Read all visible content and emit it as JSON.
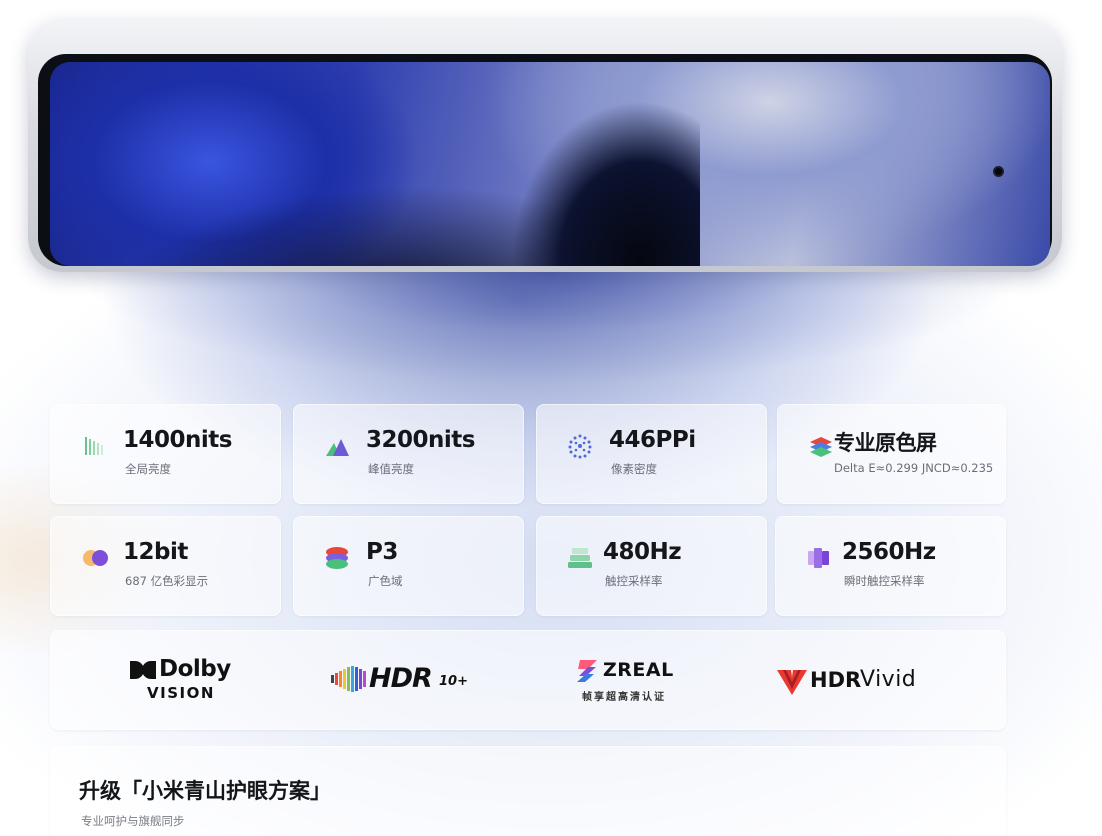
{
  "specs": [
    {
      "value": "1400nits",
      "label": "全局亮度",
      "icon": "brightness-bars-icon"
    },
    {
      "value": "3200nits",
      "label": "峰值亮度",
      "icon": "peak-mountain-icon"
    },
    {
      "value": "446PPi",
      "label": "像素密度",
      "icon": "pixel-dots-icon"
    },
    {
      "value": "专业原色屏",
      "label": "Delta E≈0.299 JNCD≈0.235",
      "icon": "color-layers-icon"
    },
    {
      "value": "12bit",
      "label": "687 亿色彩显示",
      "icon": "color-circles-icon"
    },
    {
      "value": "P3",
      "label": "广色域",
      "icon": "gamut-stack-icon"
    },
    {
      "value": "480Hz",
      "label": "触控采样率",
      "icon": "touch-layers-icon"
    },
    {
      "value": "2560Hz",
      "label": "瞬时触控采样率",
      "icon": "instant-touch-icon"
    }
  ],
  "logos": {
    "dolby_top": "Dolby",
    "dolby_bottom": "VISION",
    "hdr10": "HDR",
    "hdr10_suffix": "10+",
    "zreal": "ZREAL",
    "zreal_sub": "帧享超高清认证",
    "hdrvivid_a": "HDR",
    "hdrvivid_b": "Vivid"
  },
  "eye_care": {
    "title": "升级「小米青山护眼方案」",
    "subtitle": "专业呵护与旗舰同步"
  },
  "colors": {
    "screen_blue": "#1d2fa8",
    "text_dark": "#15161a",
    "text_muted": "#6b6e78",
    "hdrvivid_red": "#e8382f"
  }
}
